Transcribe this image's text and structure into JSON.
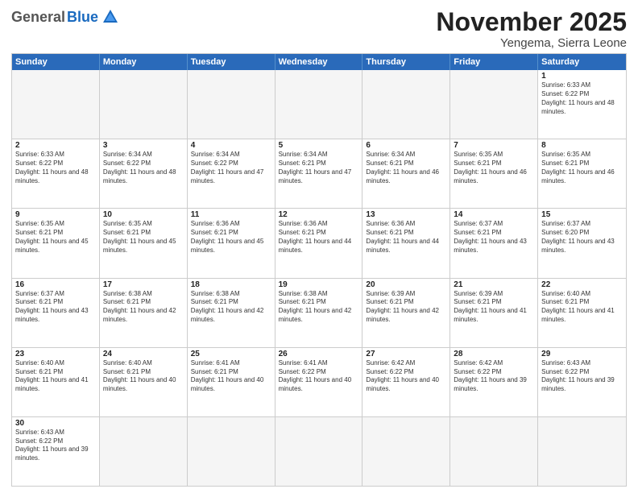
{
  "header": {
    "logo_general": "General",
    "logo_blue": "Blue",
    "month_title": "November 2025",
    "location": "Yengema, Sierra Leone"
  },
  "days_of_week": [
    "Sunday",
    "Monday",
    "Tuesday",
    "Wednesday",
    "Thursday",
    "Friday",
    "Saturday"
  ],
  "weeks": [
    [
      {
        "day": "",
        "info": ""
      },
      {
        "day": "",
        "info": ""
      },
      {
        "day": "",
        "info": ""
      },
      {
        "day": "",
        "info": ""
      },
      {
        "day": "",
        "info": ""
      },
      {
        "day": "",
        "info": ""
      },
      {
        "day": "1",
        "info": "Sunrise: 6:33 AM\nSunset: 6:22 PM\nDaylight: 11 hours and 48 minutes."
      }
    ],
    [
      {
        "day": "2",
        "info": "Sunrise: 6:33 AM\nSunset: 6:22 PM\nDaylight: 11 hours and 48 minutes."
      },
      {
        "day": "3",
        "info": "Sunrise: 6:34 AM\nSunset: 6:22 PM\nDaylight: 11 hours and 48 minutes."
      },
      {
        "day": "4",
        "info": "Sunrise: 6:34 AM\nSunset: 6:22 PM\nDaylight: 11 hours and 47 minutes."
      },
      {
        "day": "5",
        "info": "Sunrise: 6:34 AM\nSunset: 6:21 PM\nDaylight: 11 hours and 47 minutes."
      },
      {
        "day": "6",
        "info": "Sunrise: 6:34 AM\nSunset: 6:21 PM\nDaylight: 11 hours and 46 minutes."
      },
      {
        "day": "7",
        "info": "Sunrise: 6:35 AM\nSunset: 6:21 PM\nDaylight: 11 hours and 46 minutes."
      },
      {
        "day": "8",
        "info": "Sunrise: 6:35 AM\nSunset: 6:21 PM\nDaylight: 11 hours and 46 minutes."
      }
    ],
    [
      {
        "day": "9",
        "info": "Sunrise: 6:35 AM\nSunset: 6:21 PM\nDaylight: 11 hours and 45 minutes."
      },
      {
        "day": "10",
        "info": "Sunrise: 6:35 AM\nSunset: 6:21 PM\nDaylight: 11 hours and 45 minutes."
      },
      {
        "day": "11",
        "info": "Sunrise: 6:36 AM\nSunset: 6:21 PM\nDaylight: 11 hours and 45 minutes."
      },
      {
        "day": "12",
        "info": "Sunrise: 6:36 AM\nSunset: 6:21 PM\nDaylight: 11 hours and 44 minutes."
      },
      {
        "day": "13",
        "info": "Sunrise: 6:36 AM\nSunset: 6:21 PM\nDaylight: 11 hours and 44 minutes."
      },
      {
        "day": "14",
        "info": "Sunrise: 6:37 AM\nSunset: 6:21 PM\nDaylight: 11 hours and 43 minutes."
      },
      {
        "day": "15",
        "info": "Sunrise: 6:37 AM\nSunset: 6:20 PM\nDaylight: 11 hours and 43 minutes."
      }
    ],
    [
      {
        "day": "16",
        "info": "Sunrise: 6:37 AM\nSunset: 6:21 PM\nDaylight: 11 hours and 43 minutes."
      },
      {
        "day": "17",
        "info": "Sunrise: 6:38 AM\nSunset: 6:21 PM\nDaylight: 11 hours and 42 minutes."
      },
      {
        "day": "18",
        "info": "Sunrise: 6:38 AM\nSunset: 6:21 PM\nDaylight: 11 hours and 42 minutes."
      },
      {
        "day": "19",
        "info": "Sunrise: 6:38 AM\nSunset: 6:21 PM\nDaylight: 11 hours and 42 minutes."
      },
      {
        "day": "20",
        "info": "Sunrise: 6:39 AM\nSunset: 6:21 PM\nDaylight: 11 hours and 42 minutes."
      },
      {
        "day": "21",
        "info": "Sunrise: 6:39 AM\nSunset: 6:21 PM\nDaylight: 11 hours and 41 minutes."
      },
      {
        "day": "22",
        "info": "Sunrise: 6:40 AM\nSunset: 6:21 PM\nDaylight: 11 hours and 41 minutes."
      }
    ],
    [
      {
        "day": "23",
        "info": "Sunrise: 6:40 AM\nSunset: 6:21 PM\nDaylight: 11 hours and 41 minutes."
      },
      {
        "day": "24",
        "info": "Sunrise: 6:40 AM\nSunset: 6:21 PM\nDaylight: 11 hours and 40 minutes."
      },
      {
        "day": "25",
        "info": "Sunrise: 6:41 AM\nSunset: 6:21 PM\nDaylight: 11 hours and 40 minutes."
      },
      {
        "day": "26",
        "info": "Sunrise: 6:41 AM\nSunset: 6:22 PM\nDaylight: 11 hours and 40 minutes."
      },
      {
        "day": "27",
        "info": "Sunrise: 6:42 AM\nSunset: 6:22 PM\nDaylight: 11 hours and 40 minutes."
      },
      {
        "day": "28",
        "info": "Sunrise: 6:42 AM\nSunset: 6:22 PM\nDaylight: 11 hours and 39 minutes."
      },
      {
        "day": "29",
        "info": "Sunrise: 6:43 AM\nSunset: 6:22 PM\nDaylight: 11 hours and 39 minutes."
      }
    ],
    [
      {
        "day": "30",
        "info": "Sunrise: 6:43 AM\nSunset: 6:22 PM\nDaylight: 11 hours and 39 minutes."
      },
      {
        "day": "",
        "info": ""
      },
      {
        "day": "",
        "info": ""
      },
      {
        "day": "",
        "info": ""
      },
      {
        "day": "",
        "info": ""
      },
      {
        "day": "",
        "info": ""
      },
      {
        "day": "",
        "info": ""
      }
    ]
  ]
}
